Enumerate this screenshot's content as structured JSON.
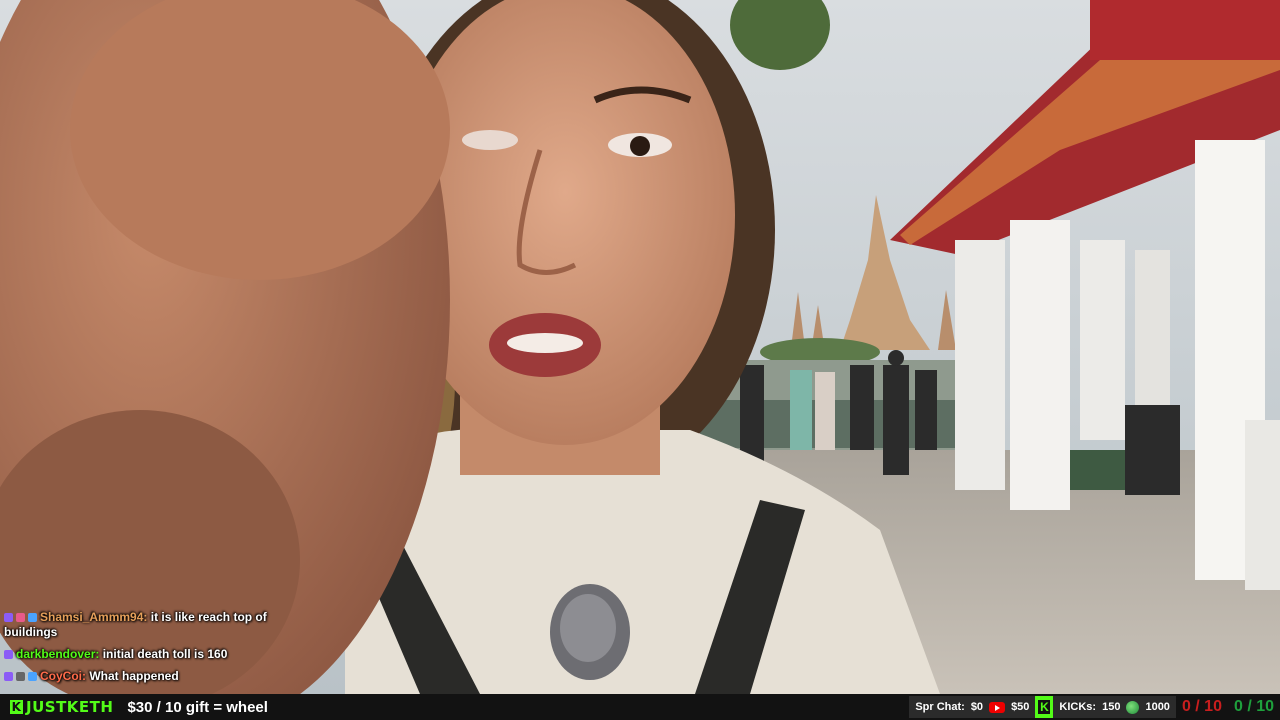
{
  "chat": {
    "messages": [
      {
        "user": "Shamsi_Ammm94:",
        "text": "it is like reach top of buildings",
        "color": "#e6a05a"
      },
      {
        "user": "darkbendover:",
        "text": "initial death toll is 160",
        "color": "#53fc18"
      },
      {
        "user": "CoyCoi:",
        "text": "What happened",
        "color": "#ff6b4a"
      }
    ]
  },
  "bottom_bar": {
    "logo": "JUSTKETH",
    "logo_icon": "kick-k-icon",
    "gift_text": "$30 / 10 gift = wheel",
    "spr_chat_label": "Spr Chat:",
    "spr_chat_value": "$0",
    "youtube_icon": "youtube-icon",
    "youtube_value": "$50",
    "kicks_label": "KICKs:",
    "kicks_value": "150",
    "globe_icon": "globe-icon",
    "globe_value": "1000",
    "counter_red": "0 / 10",
    "counter_green": "0 / 10"
  },
  "colors": {
    "kick_green": "#53fc18",
    "bar_bg": "#121212",
    "counter_red": "#c81e1e",
    "counter_green": "#1ea03c"
  }
}
